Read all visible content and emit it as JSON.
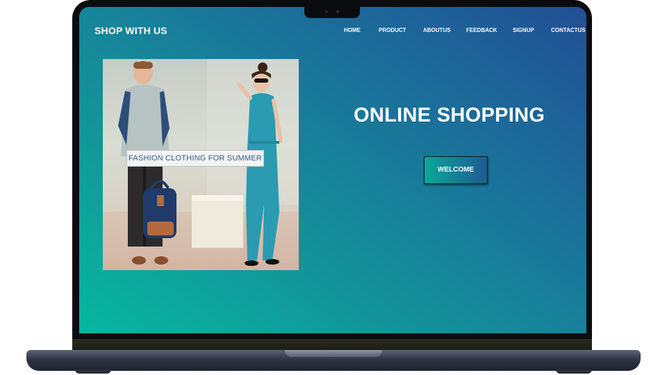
{
  "site": {
    "brand": "SHOP WITH US"
  },
  "nav": {
    "items": [
      {
        "label": "HOME"
      },
      {
        "label": "PRODUCT"
      },
      {
        "label": "ABOUTUS"
      },
      {
        "label": "FEEDBACK"
      },
      {
        "label": "SIGNUP"
      },
      {
        "label": "CONTACTUS"
      }
    ]
  },
  "hero": {
    "caption": "FASHION CLOTHING FOR SUMMER",
    "headline": "ONLINE SHOPPING",
    "button_label": "WELCOME"
  },
  "colors": {
    "gradient_start": "#06b8a0",
    "gradient_end": "#214f94",
    "text": "#ffffff",
    "caption_text": "#2e5b86"
  }
}
